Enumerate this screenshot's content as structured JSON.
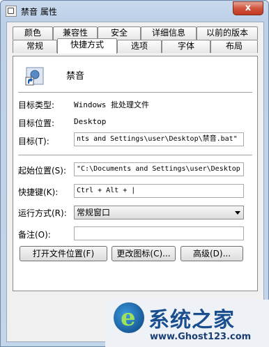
{
  "window": {
    "title": "禁音 属性",
    "close_label": "x"
  },
  "tabs_row1": [
    "颜色",
    "兼容性",
    "安全",
    "详细信息",
    "以前的版本"
  ],
  "tabs_row2": [
    "常规",
    "快捷方式",
    "选项",
    "字体",
    "布局"
  ],
  "active_tab": "快捷方式",
  "app": {
    "name": "禁音"
  },
  "fields": {
    "target_type_label": "目标类型:",
    "target_type_value": "Windows 批处理文件",
    "target_location_label": "目标位置:",
    "target_location_value": "Desktop",
    "target_label": "目标(T):",
    "target_value": "nts and Settings\\user\\Desktop\\禁音.bat\"",
    "start_in_label": "起始位置(S):",
    "start_in_value": "\"C:\\Documents and Settings\\user\\Desktop",
    "shortcut_key_label": "快捷键(K):",
    "shortcut_key_value": "Ctrl + Alt + |",
    "run_label": "运行方式(R):",
    "run_value": "常规窗口",
    "comment_label": "备注(O):",
    "comment_value": ""
  },
  "buttons": {
    "open_location": "打开文件位置(F)",
    "change_icon": "更改图标(C)...",
    "advanced": "高级(D)..."
  },
  "watermark": {
    "title": "系统之家",
    "url": "www.Ghost123.com"
  }
}
